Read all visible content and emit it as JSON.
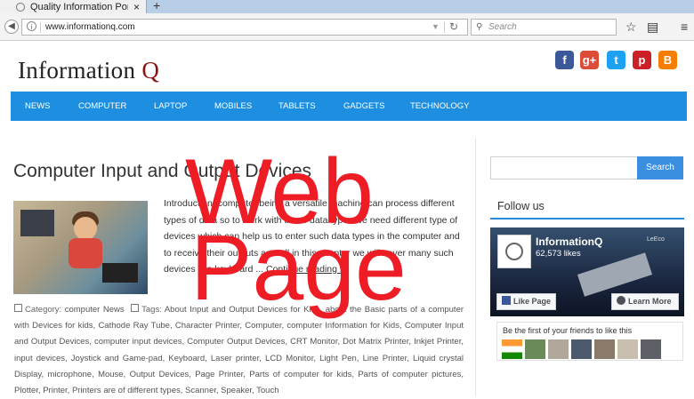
{
  "browser": {
    "tab_title": "Quality Information Portal ...",
    "tab_close": "×",
    "new_tab": "+",
    "url": "www.informationq.com",
    "search_placeholder": "Search"
  },
  "site": {
    "logo_text": "Information ",
    "logo_q": "Q"
  },
  "social": [
    {
      "name": "facebook-icon",
      "glyph": "f",
      "color": "#3b5998"
    },
    {
      "name": "google-plus-icon",
      "glyph": "g+",
      "color": "#dd4b39"
    },
    {
      "name": "twitter-icon",
      "glyph": "t",
      "color": "#1da1f2"
    },
    {
      "name": "pinterest-icon",
      "glyph": "p",
      "color": "#cb2027"
    },
    {
      "name": "blogger-icon",
      "glyph": "B",
      "color": "#f57d00"
    }
  ],
  "menu": [
    "NEWS",
    "COMPUTER",
    "LAPTOP",
    "MOBILES",
    "TABLETS",
    "GADGETS",
    "TECHNOLOGY"
  ],
  "post": {
    "title": "Computer Input and Output Devices",
    "excerpt": "Introduction: computer being a versatile machine can process different types of data so to work with these data types we need different type of devices which can help us to enter such data types in the computer and to receive their outputs as well in this chapter we will cover many such devices like keyboard ...",
    "read_more": "Continue reading »",
    "category_label": "Category:",
    "categories": "computer  News",
    "tags_label": "Tags:",
    "tags": "About Input and Output Devices for Kids, about the Basic parts of a computer with Devices for kids, Cathode Ray Tube, Character Printer, Computer, computer Information for Kids, Computer Input and Output Devices, computer input devices, Computer Output Devices, CRT Monitor, Dot Matrix Printer, Inkjet Printer, input devices, Joystick and Game-pad, Keyboard, Laser printer, LCD Monitor, Light Pen, Line Printer, Liquid crystal Display, microphone, Mouse, Output Devices, Page Printer, Parts of computer for kids, Parts of computer pictures, Plotter, Printer, Printers are of different types, Scanner, Speaker, Touch"
  },
  "sidebar": {
    "search_button": "Search",
    "follow_heading": "Follow us",
    "fb_name": "InformationQ",
    "fb_likes": "62,573 likes",
    "fb_tag": "LeEco",
    "fb_like_button": "Like Page",
    "fb_learn_more": "Learn More",
    "fb_friends_text": "Be the first of your friends to like this"
  },
  "watermark": {
    "line1": "Web",
    "line2": "Page"
  }
}
